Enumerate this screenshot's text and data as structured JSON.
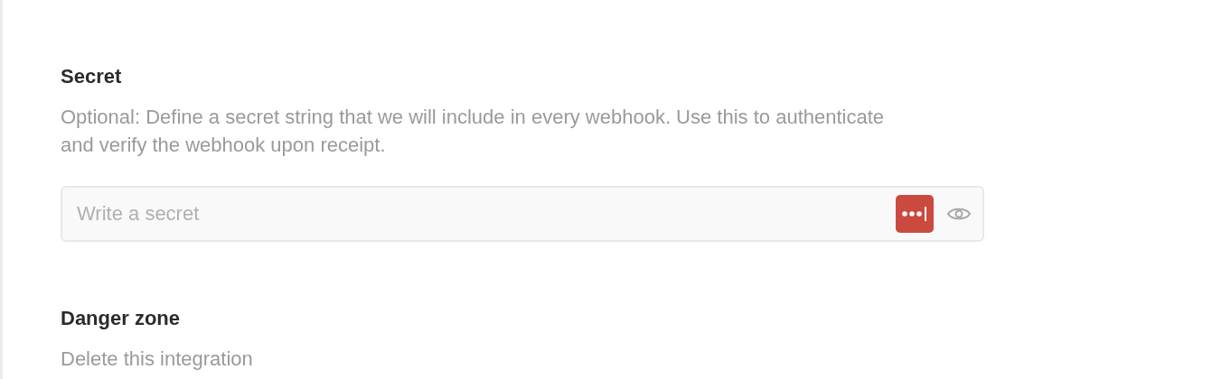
{
  "sections": [
    {
      "kind": "field",
      "heading": "Secret",
      "description": "Optional: Define a secret string that we will include in every webhook. Use this to authenticate and verify the webhook upon receipt.",
      "input": {
        "placeholder": "Write a secret"
      }
    },
    {
      "kind": "danger",
      "heading": "Danger zone",
      "description": "Delete this integration"
    }
  ]
}
